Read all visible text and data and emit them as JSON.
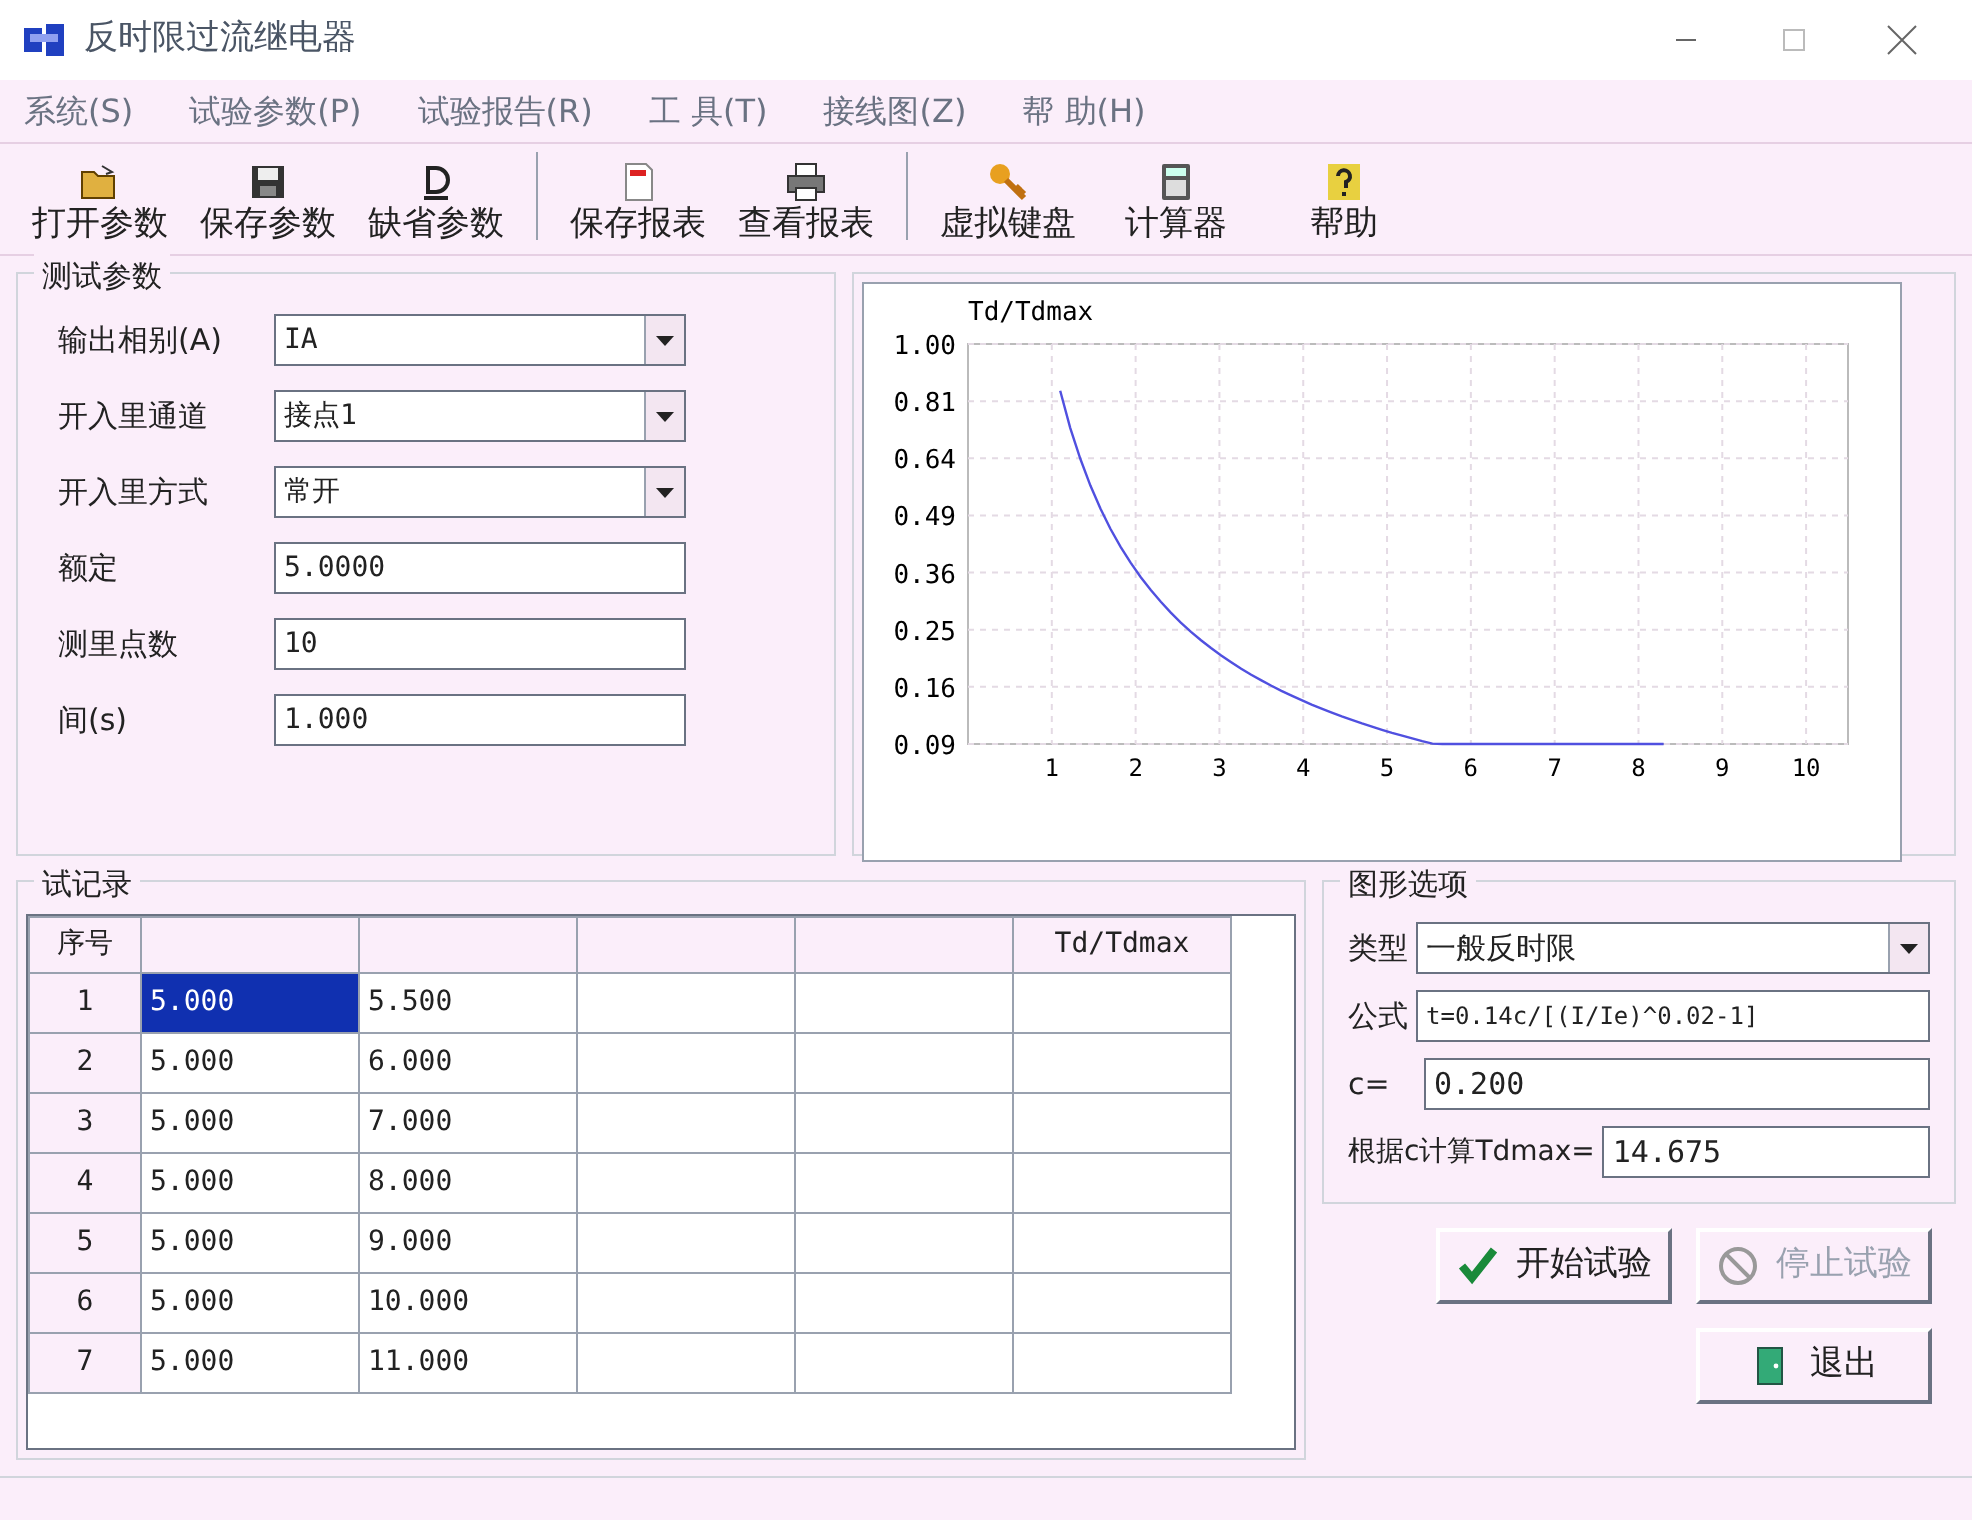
{
  "window": {
    "title": "反时限过流继电器"
  },
  "menu": [
    "系统(S)",
    "试验参数(P)",
    "试验报告(R)",
    "工 具(T)",
    "接线图(Z)",
    "帮 助(H)"
  ],
  "toolbar": [
    {
      "kind": "open",
      "label": "打开参数"
    },
    {
      "kind": "save",
      "label": "保存参数"
    },
    {
      "kind": "default",
      "label": "缺省参数"
    },
    {
      "kind": "sep"
    },
    {
      "kind": "report",
      "label": "保存报表"
    },
    {
      "kind": "print",
      "label": "查看报表"
    },
    {
      "kind": "sep"
    },
    {
      "kind": "key",
      "label": "虚拟键盘"
    },
    {
      "kind": "calc",
      "label": "计算器"
    },
    {
      "kind": "help",
      "label": "帮助"
    }
  ],
  "test_params": {
    "title": "测试参数",
    "fields": [
      {
        "kind": "select",
        "label": "输出相别(A)",
        "value": "IA"
      },
      {
        "kind": "select",
        "label": "开入里通道",
        "value": "接点1"
      },
      {
        "kind": "select",
        "label": "开入里方式",
        "value": "常开"
      },
      {
        "kind": "input",
        "label": "额定",
        "value": "5.0000"
      },
      {
        "kind": "input",
        "label": "测里点数",
        "value": "10"
      },
      {
        "kind": "input",
        "label": "间(s)",
        "value": "1.000"
      }
    ]
  },
  "chart": {
    "ylabel": "Td/Tdmax",
    "yticks": [
      "1.00",
      "0.81",
      "0.64",
      "0.49",
      "0.36",
      "0.25",
      "0.16",
      "0.09"
    ],
    "xticks": [
      "1",
      "2",
      "3",
      "4",
      "5",
      "6",
      "7",
      "8",
      "9",
      "10"
    ]
  },
  "records": {
    "title": "试记录",
    "columns": [
      {
        "label": "序号"
      },
      {},
      {},
      {},
      {},
      {
        "label": "Td/Tdmax"
      }
    ],
    "rows": [
      {
        "cells": [
          "1",
          "5.000",
          "5.500",
          "",
          "",
          ""
        ],
        "selected": true
      },
      {
        "cells": [
          "2",
          "5.000",
          "6.000",
          "",
          "",
          ""
        ],
        "selected": false
      },
      {
        "cells": [
          "3",
          "5.000",
          "7.000",
          "",
          "",
          ""
        ],
        "selected": false
      },
      {
        "cells": [
          "4",
          "5.000",
          "8.000",
          "",
          "",
          ""
        ],
        "selected": false
      },
      {
        "cells": [
          "5",
          "5.000",
          "9.000",
          "",
          "",
          ""
        ],
        "selected": false
      },
      {
        "cells": [
          "6",
          "5.000",
          "10.000",
          "",
          "",
          ""
        ],
        "selected": false
      },
      {
        "cells": [
          "7",
          "5.000",
          "11.000",
          "",
          "",
          ""
        ],
        "selected": false
      }
    ]
  },
  "curve_options": {
    "title": "图形选项",
    "type_label": "类型",
    "type_value": "一般反时限",
    "formula_label": "公式",
    "formula_value": "t=0.14c/[(I/Ie)^0.02-1]",
    "c_label": "c=",
    "c_value": "0.200",
    "tdmax_label": "根据c计算Tdmax=",
    "tdmax_value": "14.675"
  },
  "buttons": [
    {
      "kind": "start",
      "label": "开始试验",
      "disabled": false
    },
    {
      "kind": "stop",
      "label": "停止试验",
      "disabled": true
    },
    {
      "kind": "exit",
      "label": "退出",
      "disabled": false
    }
  ]
}
